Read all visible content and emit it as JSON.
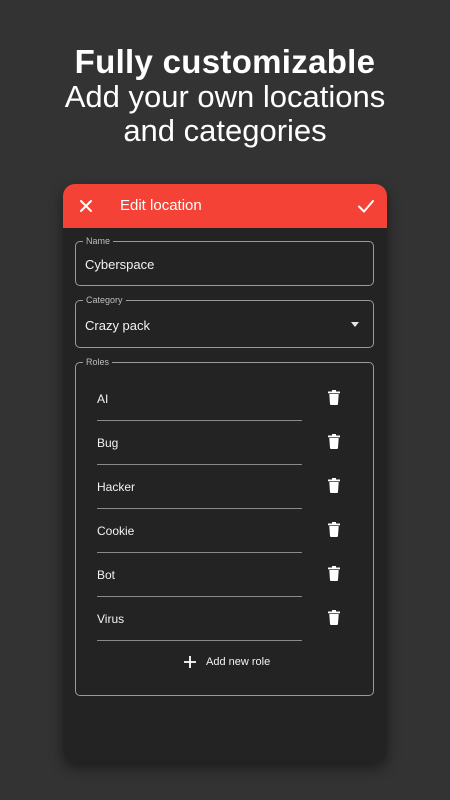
{
  "headline": {
    "title": "Fully customizable",
    "subtitle_line1": "Add your own locations",
    "subtitle_line2": "and categories"
  },
  "appbar": {
    "title": "Edit location",
    "close_icon": "close-icon",
    "confirm_icon": "check-icon",
    "color": "#f44336"
  },
  "form": {
    "name": {
      "label": "Name",
      "value": "Cyberspace"
    },
    "category": {
      "label": "Category",
      "value": "Crazy pack"
    },
    "roles": {
      "label": "Roles",
      "items": [
        {
          "label": "AI"
        },
        {
          "label": "Bug"
        },
        {
          "label": "Hacker"
        },
        {
          "label": "Cookie"
        },
        {
          "label": "Bot"
        },
        {
          "label": "Virus"
        }
      ],
      "add_label": "Add new role"
    }
  }
}
